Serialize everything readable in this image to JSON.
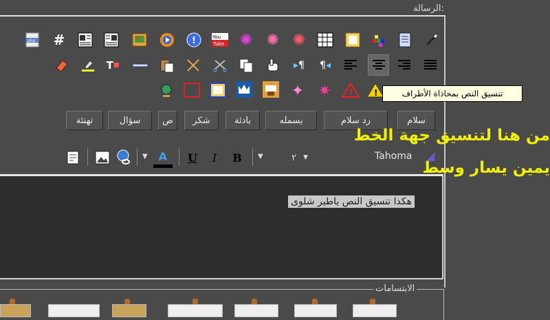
{
  "message_legend": "الرسالة:",
  "smilies_legend": "الابتسامات",
  "tooltip": "تنسيق النص بمحاذاة الأطراف",
  "editor_text": "هكذا تنسيق النص ياطير شلوى",
  "annotation": {
    "line1": "من هنا لتنسيق جهة الخط",
    "line2": "يمين يسار وسط"
  },
  "quick_buttons": [
    "سلام",
    "رد سلام",
    "بسمله",
    "بادئة",
    "شكر",
    "ص",
    "سؤال",
    "تهنئة"
  ],
  "font_toolbar": {
    "font_name": "Tahoma",
    "font_size": "٢",
    "bold": "B",
    "italic": "I",
    "underline": "U"
  },
  "colors": {
    "background": "#4a4a4a",
    "editor_bg": "#2d2d2d",
    "tooltip_bg": "#ffffe1",
    "annotation": "#f0f000"
  },
  "toolbar_row1_icons": [
    "php-icon",
    "hash-icon",
    "image-left-icon",
    "image-right-icon",
    "image-insert-icon",
    "media-player-icon",
    "real-player-icon",
    "youtube-icon",
    "firework-magenta-icon",
    "firework-pink-icon",
    "firework-red-icon",
    "table-icon",
    "frame-icon",
    "colors-icon",
    "document-icon",
    "magic-wand-icon"
  ],
  "toolbar_row2_icons": [
    "eraser-icon",
    "highlighter-icon",
    "text-color-icon",
    "horizontal-line-icon",
    "paste-icon",
    "cut-icon",
    "scissors-icon",
    "copy-icon",
    "hand-pointer-icon",
    "ltr-icon",
    "rtl-icon",
    "align-left-icon",
    "align-center-icon",
    "align-right-icon",
    "align-justify-icon"
  ],
  "toolbar_row3_icons": [
    "globe-icon",
    "red-box-icon",
    "blue-box-icon",
    "crown-icon",
    "gavel-icon",
    "sparkle-icon",
    "stars-icon",
    "warning-red-icon",
    "warning-yellow-icon"
  ]
}
